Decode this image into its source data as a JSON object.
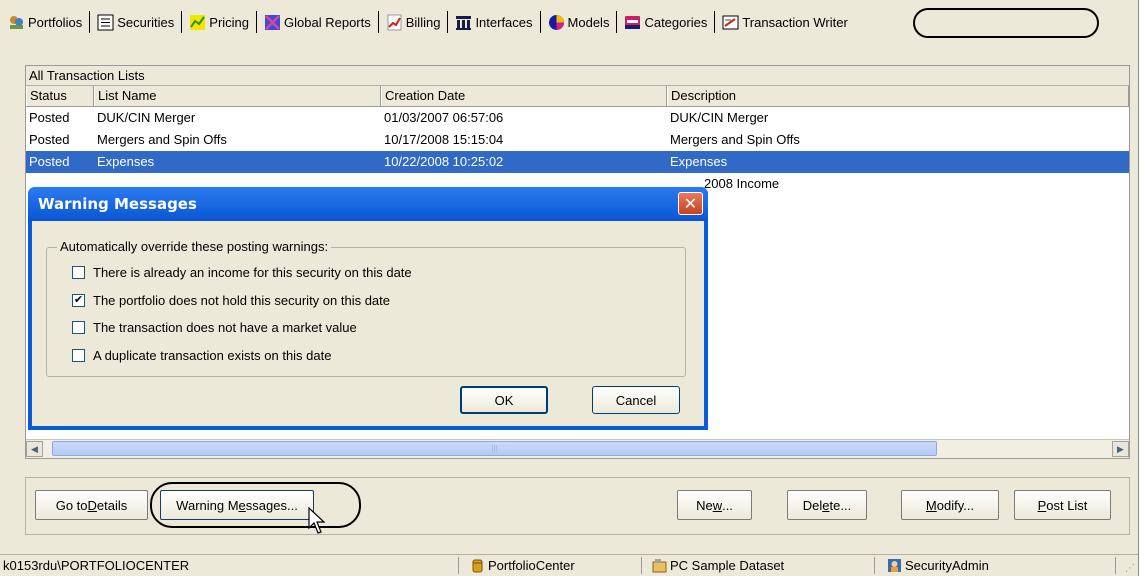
{
  "toolbar": {
    "items": [
      {
        "label": "Portfolios",
        "icon": "portfolios-icon"
      },
      {
        "label": "Securities",
        "icon": "securities-icon"
      },
      {
        "label": "Pricing",
        "icon": "pricing-icon"
      },
      {
        "label": "Global Reports",
        "icon": "global-reports-icon"
      },
      {
        "label": "Billing",
        "icon": "billing-icon"
      },
      {
        "label": "Interfaces",
        "icon": "interfaces-icon"
      },
      {
        "label": "Models",
        "icon": "models-icon"
      },
      {
        "label": "Categories",
        "icon": "categories-icon"
      },
      {
        "label": "Transaction Writer",
        "icon": "transaction-writer-icon"
      }
    ]
  },
  "list": {
    "title": "All Transaction Lists",
    "columns": [
      "Status",
      "List Name",
      "Creation Date",
      "Description"
    ],
    "rows": [
      {
        "status": "Posted",
        "name": "DUK/CIN Merger",
        "date": "01/03/2007 06:57:06",
        "description": "DUK/CIN Merger"
      },
      {
        "status": "Posted",
        "name": "Mergers and Spin Offs",
        "date": "10/17/2008 15:15:04",
        "description": "Mergers and Spin Offs"
      },
      {
        "status": "Posted",
        "name": "Expenses",
        "date": "10/22/2008 10:25:02",
        "description": "Expenses"
      },
      {
        "status": "",
        "name": "",
        "date": "",
        "description": "2008 Income"
      }
    ],
    "selected_row": 2
  },
  "buttons": {
    "go_to_details_pre": "Go to ",
    "go_to_details_u": "D",
    "go_to_details_post": "etails",
    "warning_messages_pre": "Warning M",
    "warning_messages_u": "e",
    "warning_messages_post": "ssages...",
    "new_pre": "Ne",
    "new_u": "w",
    "new_post": "...",
    "delete_pre": "Del",
    "delete_u": "e",
    "delete_post": "te...",
    "modify_u": "M",
    "modify_post": "odify...",
    "post_u": "P",
    "post_post": "ost List"
  },
  "dialog": {
    "title": "Warning Messages",
    "group_label": "Automatically override these posting warnings:",
    "options": [
      {
        "label": "There is already an income for this security on this date",
        "checked": false
      },
      {
        "label": "The portfolio does not hold this security on this date",
        "checked": true
      },
      {
        "label": "The transaction does not have a market value",
        "checked": false
      },
      {
        "label": "A duplicate transaction exists on this date",
        "checked": false
      }
    ],
    "ok": "OK",
    "cancel": "Cancel",
    "check_glyph": "✔"
  },
  "status": {
    "user": "k0153rdu\\PORTFOLIOCENTER",
    "app": "PortfolioCenter",
    "dataset": "PC Sample Dataset",
    "role": "SecurityAdmin"
  },
  "colors": {
    "selection": "#3169c6",
    "dialog_title": "#0a55d4",
    "window_bg": "#ece9d8"
  }
}
